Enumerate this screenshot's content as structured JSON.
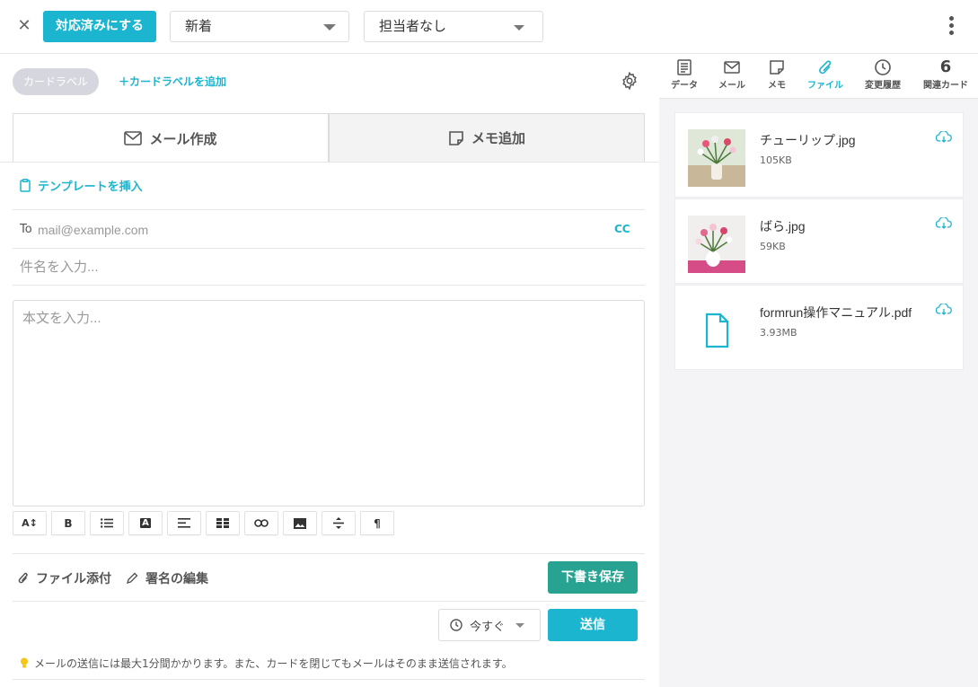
{
  "topbar": {
    "resolve_label": "対応済みにする",
    "status_value": "新着",
    "assignee_value": "担当者なし"
  },
  "labels": {
    "card_label": "カードラベル",
    "add_label": "＋カードラベルを追加"
  },
  "tabs": {
    "mail": "メール作成",
    "memo": "メモ追加"
  },
  "compose": {
    "insert_template": "テンプレートを挿入",
    "to_label": "To",
    "to_placeholder": "mail@example.com",
    "cc_label": "CC",
    "subject_placeholder": "件名を入力...",
    "body_placeholder": "本文を入力...",
    "toolbar": [
      "A↕",
      "B",
      "list",
      "A",
      "align",
      "table",
      "link",
      "image",
      "strike",
      "¶"
    ],
    "attach_label": "ファイル添付",
    "signature_label": "署名の編集",
    "draft_label": "下書き保存",
    "when_value": "今すぐ",
    "send_label": "送信",
    "notice": "メールの送信には最大1分間かかります。また、カードを閉じてもメールはそのまま送信されます。"
  },
  "sidebar": {
    "tabs": [
      {
        "label": "データ",
        "icon": "document-icon"
      },
      {
        "label": "メール",
        "icon": "mail-icon"
      },
      {
        "label": "メモ",
        "icon": "memo-icon"
      },
      {
        "label": "ファイル",
        "icon": "paperclip-icon",
        "active": true
      },
      {
        "label": "変更履歴",
        "icon": "clock-icon"
      },
      {
        "label": "関連カード",
        "count": "6"
      }
    ],
    "files": [
      {
        "name": "チューリップ.jpg",
        "size": "105KB"
      },
      {
        "name": "ばら.jpg",
        "size": "59KB"
      },
      {
        "name": "formrun操作マニュアル.pdf",
        "size": "3.93MB"
      }
    ]
  },
  "colors": {
    "accent": "#1cb5cf",
    "draft": "#28a391"
  }
}
